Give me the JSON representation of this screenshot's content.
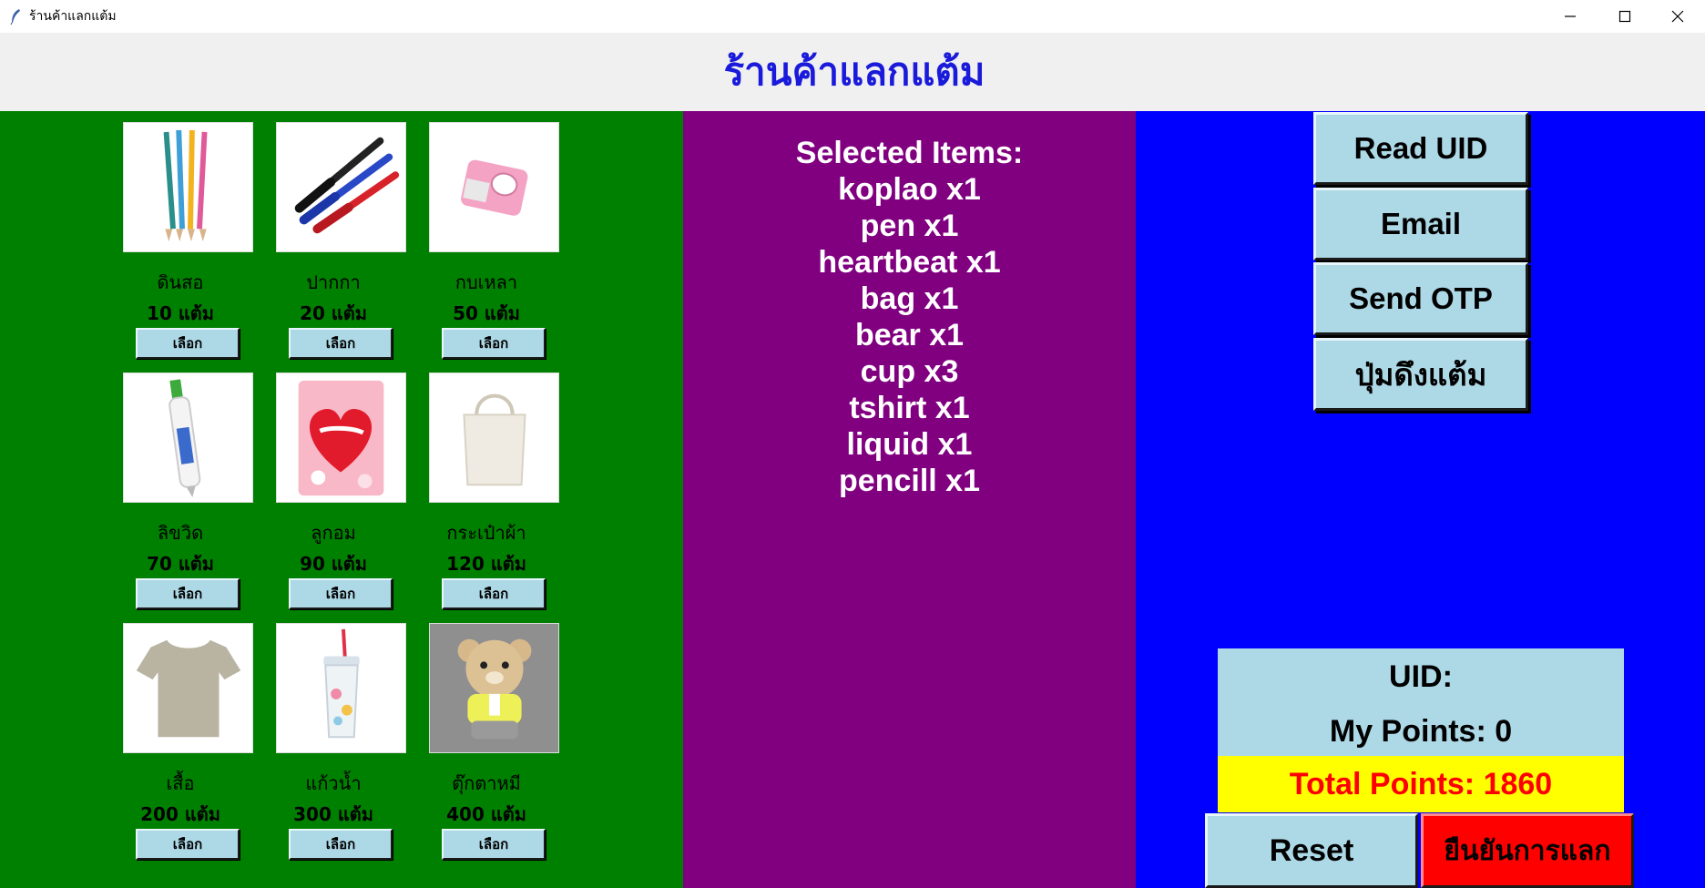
{
  "window": {
    "title": "ร้านค้าแลกแต้ม",
    "controls": [
      "minimize-icon",
      "maximize-icon",
      "close-icon"
    ]
  },
  "header": {
    "title": "ร้านค้าแลกแต้ม"
  },
  "colors": {
    "header_title": "#1a1adb",
    "left_panel": "#008000",
    "middle_panel": "#800080",
    "right_panel": "#0000ff",
    "button": "#add8e6",
    "total_bg": "#ffff00",
    "total_text": "#ff0000",
    "confirm_button": "#ff0000"
  },
  "products": [
    {
      "name": "ดินสอ",
      "price": "10 แต้ม",
      "button": "เลือก",
      "icon": "pencils-image"
    },
    {
      "name": "ปากกา",
      "price": "20 แต้ม",
      "button": "เลือก",
      "icon": "pens-image"
    },
    {
      "name": "กบเหลา",
      "price": "50 แต้ม",
      "button": "เลือก",
      "icon": "sharpener-image"
    },
    {
      "name": "ลิขวิด",
      "price": "70 แต้ม",
      "button": "เลือก",
      "icon": "correction-pen-image"
    },
    {
      "name": "ลูกอม",
      "price": "90 แต้ม",
      "button": "เลือก",
      "icon": "candy-bag-image"
    },
    {
      "name": "กระเป๋าผ้า",
      "price": "120 แต้ม",
      "button": "เลือก",
      "icon": "tote-bag-image"
    },
    {
      "name": "เสื้อ",
      "price": "200 แต้ม",
      "button": "เลือก",
      "icon": "tshirt-image"
    },
    {
      "name": "แก้วน้ำ",
      "price": "300 แต้ม",
      "button": "เลือก",
      "icon": "tumbler-image"
    },
    {
      "name": "ตุ๊กตาหมี",
      "price": "400 แต้ม",
      "button": "เลือก",
      "icon": "teddy-bear-image"
    }
  ],
  "selected": {
    "heading": "Selected Items:",
    "items": [
      "koplao x1",
      "pen x1",
      "heartbeat x1",
      "bag x1",
      "bear x1",
      "cup x3",
      "tshirt x1",
      "liquid x1",
      "pencill x1"
    ]
  },
  "actions": {
    "read_uid": "Read UID",
    "email": "Email",
    "send_otp": "Send OTP",
    "pull_points": "ปุ่มดึงแต้ม"
  },
  "account": {
    "uid": "UID:",
    "my_points": "My Points: 0",
    "total_points": "Total Points: 1860"
  },
  "footer": {
    "reset": "Reset",
    "confirm": "ยืนยันการแลก"
  }
}
